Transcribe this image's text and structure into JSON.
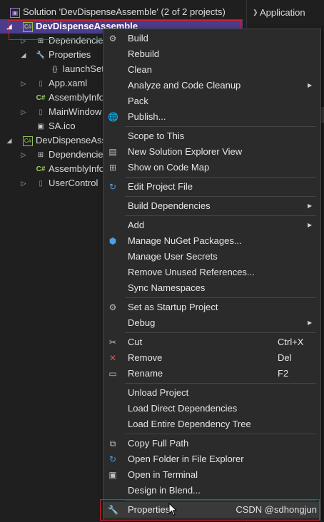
{
  "solution_explorer": {
    "solution_label": "Solution 'DevDispenseAssemble' (2 of 2 projects)",
    "project1": "DevDispenseAssemble",
    "items": [
      {
        "label": "Dependencie",
        "icon": "dependencies-icon"
      },
      {
        "label": "Properties",
        "icon": "folder-icon"
      },
      {
        "label": "launchSet",
        "icon": "json-file-icon"
      },
      {
        "label": "App.xaml",
        "icon": "xaml-file-icon"
      },
      {
        "label": "AssemblyInfo",
        "icon": "csharp-file-icon"
      },
      {
        "label": "MainWindow",
        "icon": "xaml-file-icon"
      },
      {
        "label": "SA.ico",
        "icon": "ico-file-icon"
      }
    ],
    "project2": "DevDispenseAss",
    "items2": [
      {
        "label": "Dependencie",
        "icon": "dependencies-icon"
      },
      {
        "label": "AssemblyInfo",
        "icon": "csharp-file-icon"
      },
      {
        "label": "UserControl",
        "icon": "xaml-file-icon"
      }
    ]
  },
  "right_panel": {
    "application_label": "Application"
  },
  "context_menu": {
    "build": "Build",
    "rebuild": "Rebuild",
    "clean": "Clean",
    "analyze": "Analyze and Code Cleanup",
    "pack": "Pack",
    "publish": "Publish...",
    "scope": "Scope to This",
    "new_view": "New Solution Explorer View",
    "code_map": "Show on Code Map",
    "edit_project": "Edit Project File",
    "build_deps": "Build Dependencies",
    "add": "Add",
    "nuget": "Manage NuGet Packages...",
    "secrets": "Manage User Secrets",
    "remove_refs": "Remove Unused References...",
    "sync_ns": "Sync Namespaces",
    "startup": "Set as Startup Project",
    "debug": "Debug",
    "cut": "Cut",
    "cut_shortcut": "Ctrl+X",
    "remove": "Remove",
    "remove_shortcut": "Del",
    "rename": "Rename",
    "rename_shortcut": "F2",
    "unload": "Unload Project",
    "load_direct": "Load Direct Dependencies",
    "load_tree": "Load Entire Dependency Tree",
    "copy_path": "Copy Full Path",
    "open_folder": "Open Folder in File Explorer",
    "open_terminal": "Open in Terminal",
    "design_blend": "Design in Blend...",
    "properties": "Properties"
  },
  "watermark": "CSDN @sdhongjun",
  "colors": {
    "selection": "#4b3c8c",
    "highlight_box": "#d4202a",
    "menu_bg": "#2b2b2b"
  }
}
